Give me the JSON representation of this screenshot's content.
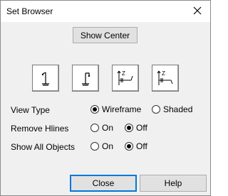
{
  "window": {
    "title": "Set Browser",
    "close_icon": "close-icon"
  },
  "show_center_button": "Show Center",
  "icon_buttons": [
    {
      "icon": "plumb-stand-icon"
    },
    {
      "icon": "angled-stand-icon"
    },
    {
      "icon": "z-axis-left-icon"
    },
    {
      "icon": "z-axis-right-icon"
    }
  ],
  "options": {
    "view_type": {
      "label": "View Type",
      "choices": [
        "Wireframe",
        "Shaded"
      ],
      "selected": "Wireframe"
    },
    "remove_hlines": {
      "label": "Remove Hlines",
      "choices": [
        "On",
        "Off"
      ],
      "selected": "Off"
    },
    "show_all_objects": {
      "label": "Show All Objects",
      "choices": [
        "On",
        "Off"
      ],
      "selected": "Off"
    }
  },
  "footer": {
    "close_label": "Close",
    "help_label": "Help"
  }
}
